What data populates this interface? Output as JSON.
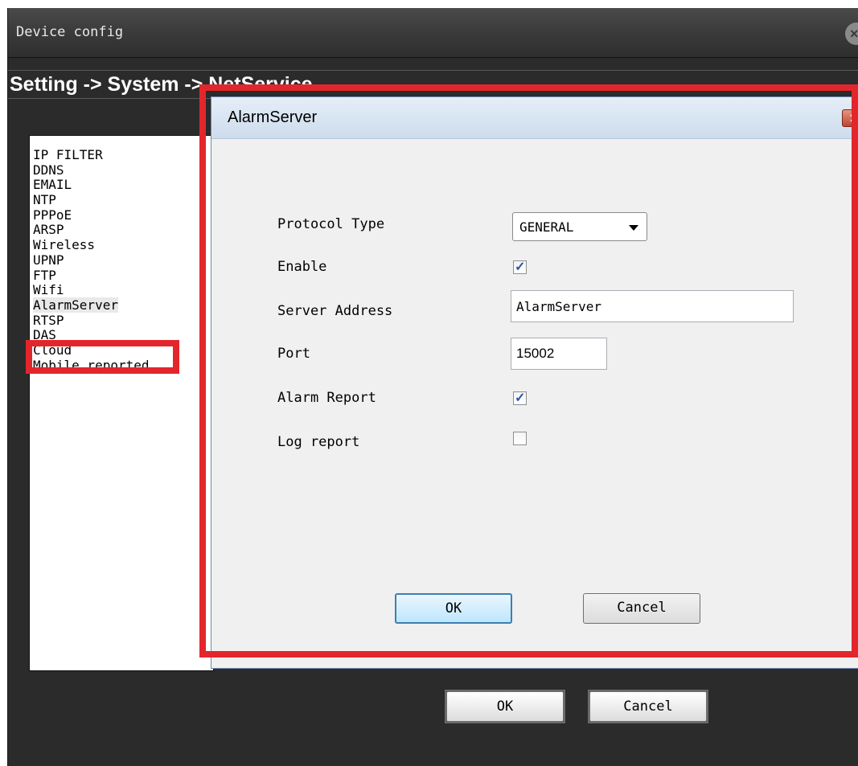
{
  "window": {
    "title": "Device config",
    "close_glyph": "×"
  },
  "breadcrumb": "Setting -> System -> NetService",
  "menu": {
    "items": [
      {
        "label": "IP FILTER"
      },
      {
        "label": "DDNS"
      },
      {
        "label": "EMAIL"
      },
      {
        "label": "NTP"
      },
      {
        "label": "PPPoE"
      },
      {
        "label": "ARSP"
      },
      {
        "label": "Wireless"
      },
      {
        "label": "UPNP"
      },
      {
        "label": "FTP"
      },
      {
        "label": "Wifi"
      },
      {
        "label": "AlarmServer"
      },
      {
        "label": "RTSP"
      },
      {
        "label": "DAS"
      },
      {
        "label": "Cloud"
      },
      {
        "label": "Mobile reported"
      }
    ],
    "selected": "AlarmServer"
  },
  "footer": {
    "ok_label": "OK",
    "cancel_label": "Cancel"
  },
  "dialog": {
    "title": "AlarmServer",
    "close_glyph": "✕",
    "fields": {
      "protocol_type_label": "Protocol Type",
      "protocol_type_value": "GENERAL",
      "enable_label": "Enable",
      "enable_checked": true,
      "server_address_label": "Server Address",
      "server_address_value": "AlarmServer",
      "port_label": "Port",
      "port_value": "15002",
      "alarm_report_label": "Alarm Report",
      "alarm_report_checked": true,
      "log_report_label": "Log report",
      "log_report_checked": false
    },
    "ok_label": "OK",
    "cancel_label": "Cancel"
  },
  "colors": {
    "highlight": "#e3262b",
    "outer_bg": "#2b2b2b",
    "dialog_bg": "#f0f0f0",
    "checkbox_check": "#2a56a8"
  }
}
